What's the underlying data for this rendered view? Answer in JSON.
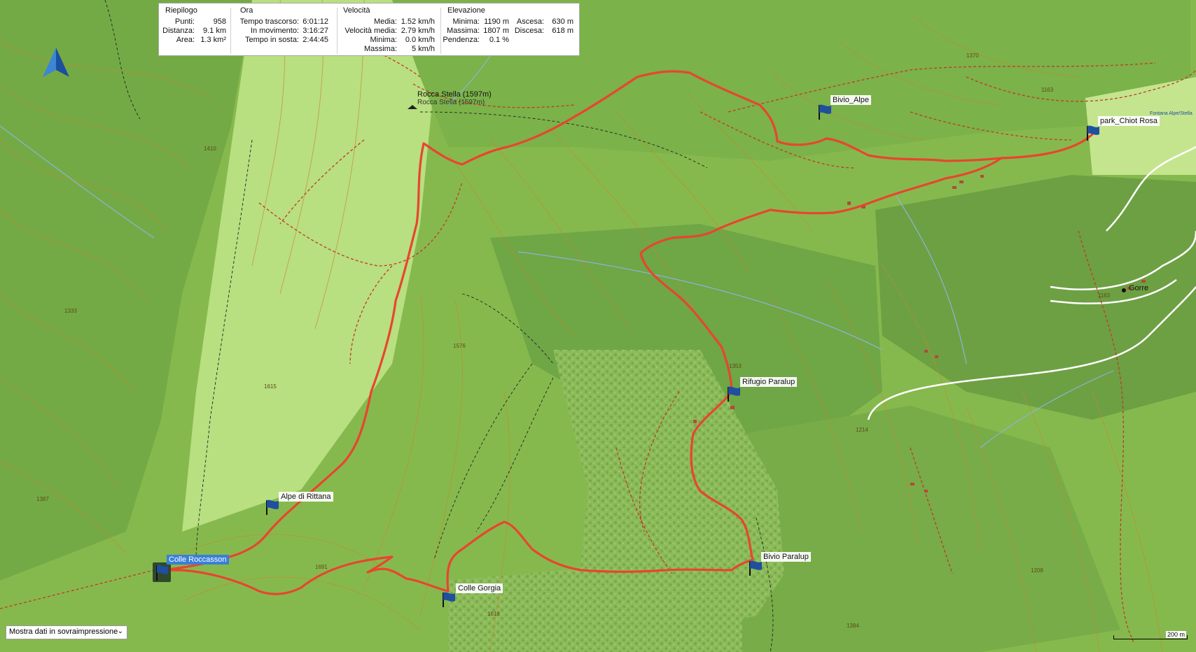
{
  "summary": {
    "title": "Riepilogo",
    "rows": [
      {
        "label": "Punti:",
        "value": "958"
      },
      {
        "label": "Distanza:",
        "value": "9.1 km"
      },
      {
        "label": "Area:",
        "value": "1.3 km²"
      }
    ]
  },
  "time": {
    "title": "Ora",
    "rows": [
      {
        "label": "Tempo trascorso:",
        "value": "6:01:12"
      },
      {
        "label": "In movimento:",
        "value": "3:16:27"
      },
      {
        "label": "Tempo in sosta:",
        "value": "2:44:45"
      }
    ]
  },
  "speed": {
    "title": "Velocità",
    "rows": [
      {
        "label": "Media:",
        "value": "1.52 km/h"
      },
      {
        "label": "Velocità media:",
        "value": "2.79 km/h"
      },
      {
        "label": "Minima:",
        "value": "0.0 km/h"
      },
      {
        "label": "Massima:",
        "value": "5 km/h"
      }
    ]
  },
  "elevation": {
    "title": "Elevazione",
    "rows": [
      {
        "label": "Minima:",
        "value": "1190 m"
      },
      {
        "label": "Massima:",
        "value": "1807 m"
      },
      {
        "label": "Pendenza:",
        "value": "0.1 %"
      }
    ],
    "rows2": [
      {
        "label": "Ascesa:",
        "value": "630 m"
      },
      {
        "label": "Discesa:",
        "value": "618 m"
      }
    ]
  },
  "waypoints": [
    {
      "name": "Colle Roccasson",
      "selected": true
    },
    {
      "name": "Alpe di Rittana",
      "selected": false
    },
    {
      "name": "Colle  Gorgia",
      "selected": false
    },
    {
      "name": "Bivio Paralup",
      "selected": false
    },
    {
      "name": "Rifugio Paralup",
      "selected": false
    },
    {
      "name": "Bivio_Alpe",
      "selected": false
    },
    {
      "name": "park_Chiot Rosa",
      "selected": false
    }
  ],
  "map_labels": {
    "peak": "Rocca Stella (1597m)",
    "peak_sub": "Rocca Stella (1597m)",
    "village": "Gorre",
    "place_small": "Fontana Alpe/Stella"
  },
  "contour_numbers": [
    "1370",
    "1163",
    "1410",
    "1333",
    "1615",
    "1576",
    "1387",
    "1691",
    "1618",
    "1353",
    "1214",
    "1384",
    "1208",
    "1163"
  ],
  "overlay_dropdown": {
    "label": "Mostra dati in sovraimpressione"
  },
  "scale": {
    "label": "200 m"
  },
  "colors": {
    "track": "#e8452f",
    "track_dashed": "#c0392b",
    "forest": "#6ea44a",
    "meadow": "#b5dd7a",
    "road": "#ffffff",
    "water": "#8ab4d8",
    "flag": "#1f4f9e",
    "selected_label": "#3a7fd8"
  }
}
